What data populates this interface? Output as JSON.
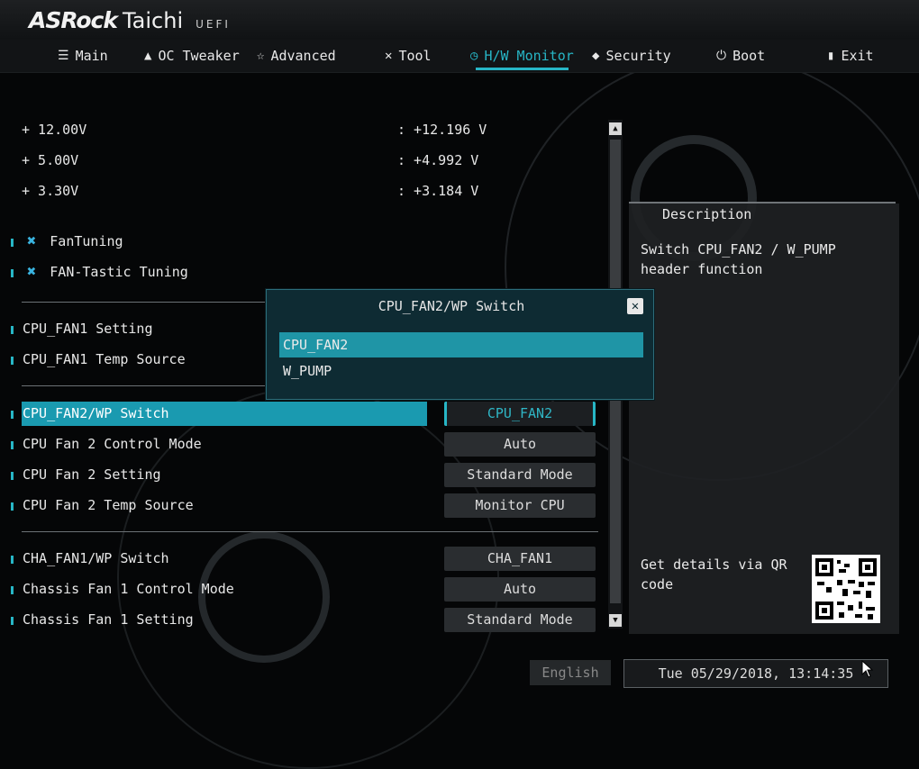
{
  "header": {
    "brand": "ASRock",
    "model": "Taichi",
    "suffix": "UEFI"
  },
  "nav": {
    "tabs": [
      {
        "icon": "list",
        "label": "Main"
      },
      {
        "icon": "rocket",
        "label": "OC Tweaker"
      },
      {
        "icon": "star",
        "label": "Advanced"
      },
      {
        "icon": "tool",
        "label": "Tool"
      },
      {
        "icon": "monitor",
        "label": "H/W Monitor"
      },
      {
        "icon": "shield",
        "label": "Security"
      },
      {
        "icon": "power",
        "label": "Boot"
      },
      {
        "icon": "exit",
        "label": "Exit"
      }
    ],
    "active": "H/W Monitor"
  },
  "voltages": [
    {
      "label": "+ 12.00V",
      "value": ": +12.196 V"
    },
    {
      "label": "+ 5.00V",
      "value": ": +4.992 V"
    },
    {
      "label": "+ 3.30V",
      "value": ": +3.184 V"
    }
  ],
  "tools": [
    {
      "icon": "wrench-cross",
      "label": "FanTuning"
    },
    {
      "icon": "wrench-cross",
      "label": "FAN-Tastic Tuning"
    }
  ],
  "settings": [
    {
      "label": "CPU_FAN1 Setting",
      "value": ""
    },
    {
      "label": "CPU_FAN1 Temp Source",
      "value": ""
    },
    {
      "label": "CPU_FAN2/WP Switch",
      "value": "CPU_FAN2"
    },
    {
      "label": "CPU Fan 2 Control Mode",
      "value": "Auto"
    },
    {
      "label": "CPU Fan 2 Setting",
      "value": "Standard Mode"
    },
    {
      "label": "CPU Fan 2 Temp Source",
      "value": "Monitor CPU"
    },
    {
      "label": "CHA_FAN1/WP Switch",
      "value": "CHA_FAN1"
    },
    {
      "label": "Chassis Fan 1 Control Mode",
      "value": "Auto"
    },
    {
      "label": "Chassis Fan 1 Setting",
      "value": "Standard Mode"
    }
  ],
  "description": {
    "title": "Description",
    "text": "Switch CPU_FAN2 / W_PUMP header function",
    "qr_text": "Get details via QR code"
  },
  "modal": {
    "title": "CPU_FAN2/WP Switch",
    "options": [
      "CPU_FAN2",
      "W_PUMP"
    ],
    "selected": "CPU_FAN2"
  },
  "footer": {
    "language": "English",
    "datetime": "Tue 05/29/2018, 13:14:35"
  },
  "colors": {
    "accent": "#27b6c6",
    "highlight": "#1a9ab0",
    "modal_bg": "#0e2b33"
  }
}
